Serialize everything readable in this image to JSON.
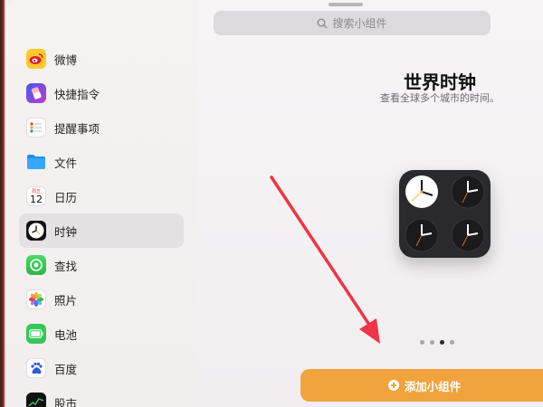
{
  "search": {
    "placeholder": "搜索小组件"
  },
  "sidebar": {
    "items": [
      {
        "label": "微博",
        "icon": "weibo-icon",
        "active": false
      },
      {
        "label": "快捷指令",
        "icon": "shortcuts-icon",
        "active": false
      },
      {
        "label": "提醒事项",
        "icon": "reminders-icon",
        "active": false
      },
      {
        "label": "文件",
        "icon": "files-icon",
        "active": false
      },
      {
        "label": "日历",
        "icon": "calendar-icon",
        "active": false
      },
      {
        "label": "时钟",
        "icon": "clock-icon",
        "active": true
      },
      {
        "label": "查找",
        "icon": "find-my-icon",
        "active": false
      },
      {
        "label": "照片",
        "icon": "photos-icon",
        "active": false
      },
      {
        "label": "电池",
        "icon": "battery-icon",
        "active": false
      },
      {
        "label": "百度",
        "icon": "baidu-icon",
        "active": false
      },
      {
        "label": "股市",
        "icon": "stocks-icon",
        "active": false
      }
    ]
  },
  "calendar_icon": {
    "weekday": "周五",
    "day": "12"
  },
  "content": {
    "title": "世界时钟",
    "subtitle": "查看全球多个城市的时间。"
  },
  "widget": {
    "type": "world-clock",
    "clock_count": 4
  },
  "pager": {
    "pages": 4,
    "current": 3
  },
  "add_button": {
    "label": "添加小组件"
  },
  "colors": {
    "accent": "#f1a33c",
    "annotation_arrow": "#ee3446"
  }
}
